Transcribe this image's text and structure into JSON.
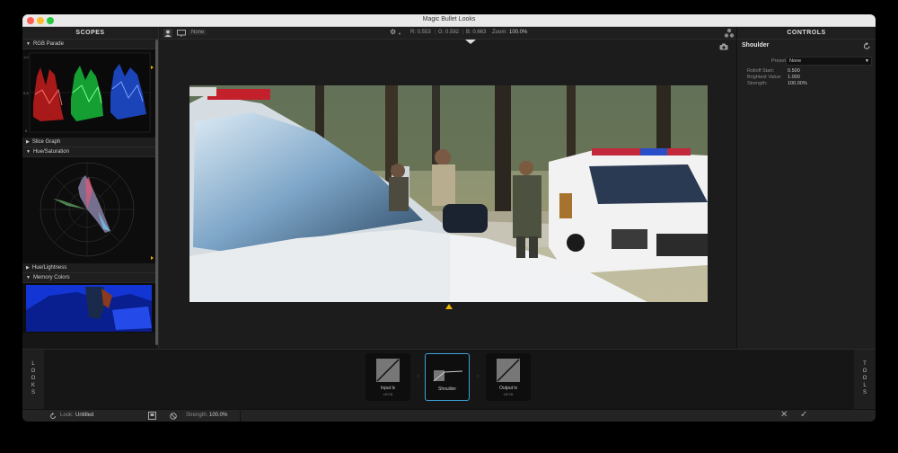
{
  "window": {
    "title": "Magic Bullet Looks"
  },
  "scopes": {
    "header": "SCOPES",
    "sections": [
      "RGB Parade",
      "Slice Graph",
      "Hue/Saturation",
      "Hue/Lightness",
      "Memory Colors"
    ],
    "parade_ticks": [
      "1.0",
      "0.5",
      "0"
    ]
  },
  "toolbar": {
    "preset_view": "None",
    "r_readout": "R: 0.553",
    "g_readout": "G: 0.592",
    "b_readout": "B: 0.663",
    "zoom_label": "Zoom:",
    "zoom_value": "100.0%"
  },
  "controls": {
    "header": "CONTROLS",
    "tool_name": "Shoulder",
    "preset_label": "Preset:",
    "preset_value": "None",
    "params": [
      {
        "label": "Rolloff Start:",
        "value": "0.500"
      },
      {
        "label": "Brightest Value:",
        "value": "1.000"
      },
      {
        "label": "Strength:",
        "value": "100.00%"
      }
    ]
  },
  "tray": {
    "left_tab": "LOOKS",
    "right_tab": "TOOLS",
    "tools": [
      {
        "label": "Input lx",
        "sub": "sRGB"
      },
      {
        "label": "Shoulder",
        "sub": ""
      },
      {
        "label": "Output lx",
        "sub": "sRGB"
      }
    ]
  },
  "status": {
    "look_label": "Look:",
    "look_name": "Untitled",
    "strength_label": "Strength:",
    "strength_value": "100.0%"
  },
  "colors": {
    "accent": "#3aa3d8",
    "marker": "#e8b400"
  }
}
